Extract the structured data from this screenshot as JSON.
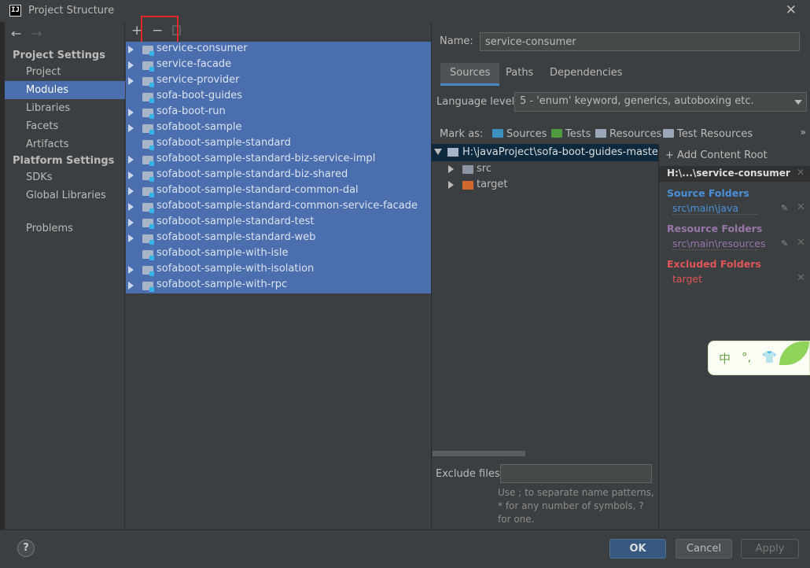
{
  "window": {
    "title": "Project Structure",
    "app_icon_text": "IJ"
  },
  "sidebar": {
    "sections": [
      {
        "label": "Project Settings",
        "items": [
          "Project",
          "Modules",
          "Libraries",
          "Facets",
          "Artifacts"
        ]
      },
      {
        "label": "Platform Settings",
        "items": [
          "SDKs",
          "Global Libraries"
        ]
      }
    ],
    "problems": "Problems",
    "selected": "Modules"
  },
  "modules_toolbar": {
    "add": "+",
    "remove": "−"
  },
  "modules": [
    {
      "name": "service-consumer",
      "expandable": true
    },
    {
      "name": "service-facade",
      "expandable": true
    },
    {
      "name": "service-provider",
      "expandable": true
    },
    {
      "name": "sofa-boot-guides",
      "expandable": false
    },
    {
      "name": "sofa-boot-run",
      "expandable": true
    },
    {
      "name": "sofaboot-sample",
      "expandable": true
    },
    {
      "name": "sofaboot-sample-standard",
      "expandable": false
    },
    {
      "name": "sofaboot-sample-standard-biz-service-impl",
      "expandable": true
    },
    {
      "name": "sofaboot-sample-standard-biz-shared",
      "expandable": true
    },
    {
      "name": "sofaboot-sample-standard-common-dal",
      "expandable": true
    },
    {
      "name": "sofaboot-sample-standard-common-service-facade",
      "expandable": true
    },
    {
      "name": "sofaboot-sample-standard-test",
      "expandable": true
    },
    {
      "name": "sofaboot-sample-standard-web",
      "expandable": true
    },
    {
      "name": "sofaboot-sample-with-isle",
      "expandable": false
    },
    {
      "name": "sofaboot-sample-with-isolation",
      "expandable": true
    },
    {
      "name": "sofaboot-sample-with-rpc",
      "expandable": true
    }
  ],
  "detail": {
    "name_label": "Name:",
    "name_value": "service-consumer",
    "tabs": [
      "Sources",
      "Paths",
      "Dependencies"
    ],
    "active_tab": "Sources",
    "language_level_label": "Language level:",
    "language_level_value": "5 - 'enum' keyword, generics, autoboxing etc.",
    "mark_as_label": "Mark as:",
    "mark_as": [
      {
        "label": "Sources",
        "color": "#3d8fbf"
      },
      {
        "label": "Tests",
        "color": "#4f9a3f"
      },
      {
        "label": "Resources",
        "color": "#9aa7b8"
      },
      {
        "label": "Test Resources",
        "color": "#9aa7b8"
      }
    ],
    "more": "»",
    "tree": {
      "root": "H:\\javaProject\\sofa-boot-guides-master\\service-consumer",
      "children": [
        {
          "label": "src",
          "color": "#8c96a3"
        },
        {
          "label": "target",
          "color": "#d1692c"
        }
      ]
    },
    "exclude_files_label": "Exclude files:",
    "exclude_hint": "Use ; to separate name patterns, * for any number of symbols, ? for one."
  },
  "content_root": {
    "add_label": "+ Add Content Root",
    "path": "H:\\...\\service-consumer",
    "source_folders_label": "Source Folders",
    "source_folder": "src\\main\\java",
    "resource_folders_label": "Resource Folders",
    "resource_folder": "src\\main\\resources",
    "excluded_folders_label": "Excluded Folders",
    "excluded_folder": "target",
    "colors": {
      "source": "#4a90d9",
      "resource": "#9876aa",
      "excluded": "#e05555"
    }
  },
  "ime": {
    "chars": [
      "中",
      "°,",
      "👕"
    ]
  },
  "footer": {
    "help": "?",
    "ok": "OK",
    "cancel": "Cancel",
    "apply": "Apply"
  }
}
